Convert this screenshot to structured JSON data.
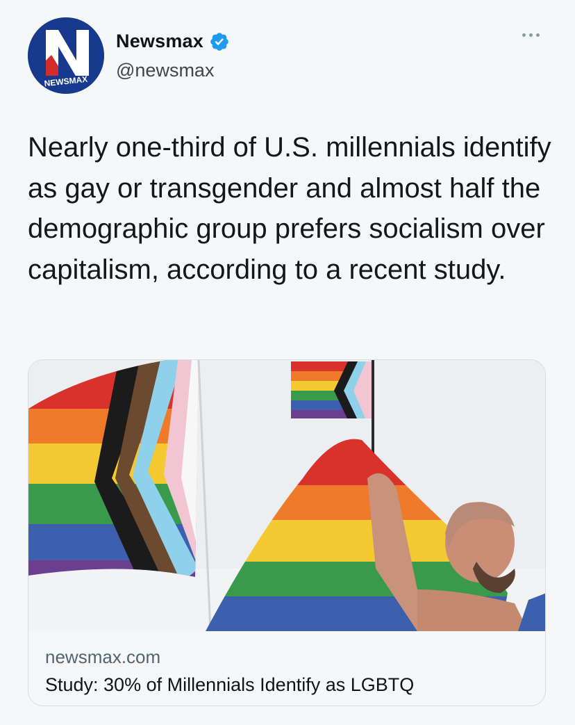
{
  "author": {
    "display_name": "Newsmax",
    "handle": "@newsmax",
    "verified": true,
    "avatar": {
      "icon": "newsmax-logo-icon",
      "logo_letter": "N",
      "logo_text": "NEWSMAX"
    }
  },
  "tweet": {
    "text": "Nearly one-third of U.S. millennials identify as gay or transgender and almost half the demographic group prefers socialism over capitalism, according to a recent study."
  },
  "link_card": {
    "image": "photo-pride-flags",
    "domain": "newsmax.com",
    "title": "Study: 30% of Millennials Identify as LGBTQ"
  },
  "menu": {
    "icon": "more-options-icon"
  },
  "colors": {
    "background": "#f5f7f8",
    "brand_blue": "#173a8f",
    "verified_blue": "#1d9bf0",
    "secondary_text": "#536471",
    "card_border": "#d6dde3"
  }
}
